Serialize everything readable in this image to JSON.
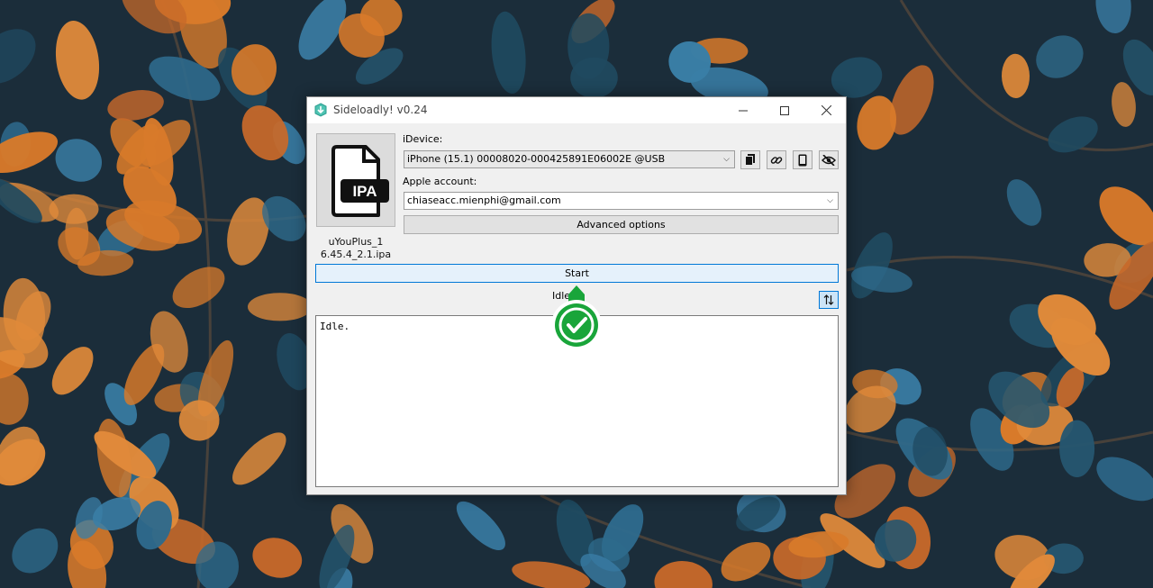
{
  "window": {
    "title": "Sideloadly! v0.24",
    "controls": {
      "minimize": "minimize",
      "maximize": "maximize",
      "close": "close"
    }
  },
  "ipa": {
    "icon_label": "IPA",
    "file_name_line1": "uYouPlus_1",
    "file_name_line2": "6.45.4_2.1.ipa"
  },
  "device": {
    "label": "iDevice:",
    "selected": "iPhone (15.1) 00008020-000425891E06002E @USB",
    "tools": [
      "copy-icon",
      "link-icon",
      "phone-icon",
      "eye-slash-icon"
    ]
  },
  "account": {
    "label": "Apple account:",
    "selected": "chiaseacc.mienphi@gmail.com"
  },
  "buttons": {
    "advanced": "Advanced options",
    "start": "Start"
  },
  "status": {
    "text": "Idle",
    "log": "Idle."
  },
  "colors": {
    "accent": "#0078d7",
    "badge_green": "#19a53a"
  }
}
